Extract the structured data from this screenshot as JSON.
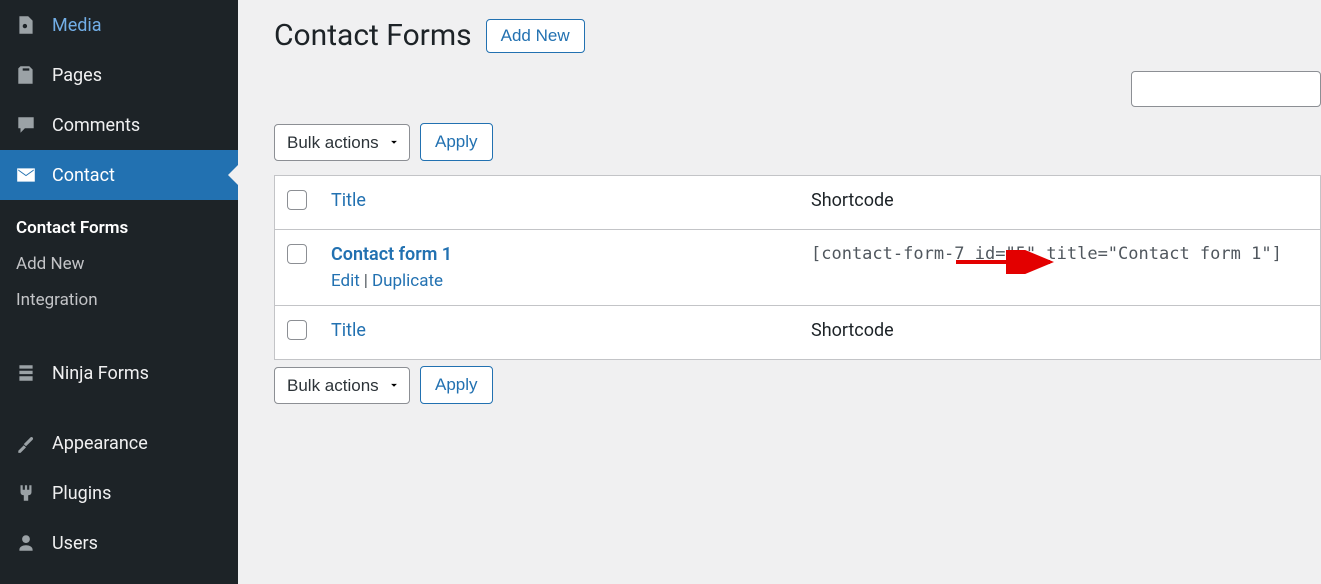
{
  "sidebar": {
    "items": [
      {
        "label": "Media",
        "icon": "media"
      },
      {
        "label": "Pages",
        "icon": "pages"
      },
      {
        "label": "Comments",
        "icon": "comments"
      },
      {
        "label": "Contact",
        "icon": "mail",
        "current": true,
        "submenu": [
          {
            "label": "Contact Forms",
            "current": true
          },
          {
            "label": "Add New"
          },
          {
            "label": "Integration"
          }
        ]
      },
      {
        "label": "Ninja Forms",
        "icon": "form"
      },
      {
        "label": "Appearance",
        "icon": "appearance"
      },
      {
        "label": "Plugins",
        "icon": "plugins"
      },
      {
        "label": "Users",
        "icon": "users"
      }
    ]
  },
  "header": {
    "title": "Contact Forms",
    "add_new": "Add New"
  },
  "search_placeholder": "",
  "bulk": {
    "label": "Bulk actions",
    "apply": "Apply"
  },
  "table": {
    "col_title": "Title",
    "col_shortcode": "Shortcode",
    "rows": [
      {
        "title": "Contact form 1",
        "edit": "Edit",
        "duplicate": "Duplicate",
        "shortcode": "[contact-form-7 id=\"5\" title=\"Contact form 1\"]"
      }
    ]
  }
}
